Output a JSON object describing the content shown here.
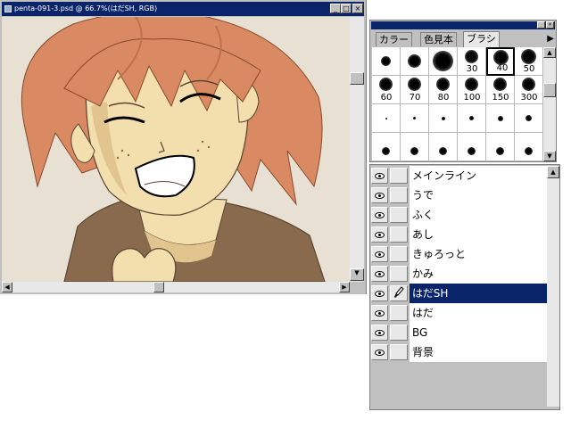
{
  "document": {
    "title": "penta-091-3.psd @ 66.7%(はだSH, RGB)",
    "buttons": {
      "minimize": "_",
      "maximize": "□",
      "close": "×"
    }
  },
  "brushes": {
    "tabs": [
      "カラー",
      "色見本",
      "ブラシ"
    ],
    "active_tab": "ブラシ",
    "tab_menu_icon": "triangle-right-icon",
    "close_glyph": "×",
    "rows": [
      [
        "",
        "",
        "",
        "30",
        "40",
        "50"
      ],
      [
        "60",
        "70",
        "80",
        "100",
        "150",
        "300"
      ],
      [
        "",
        "",
        "",
        "",
        "",
        ""
      ]
    ],
    "selected": "40"
  },
  "layers": {
    "items": [
      {
        "name": "メインライン",
        "visible": true,
        "active": false
      },
      {
        "name": "うで",
        "visible": true,
        "active": false
      },
      {
        "name": "ふく",
        "visible": true,
        "active": false
      },
      {
        "name": "あし",
        "visible": true,
        "active": false
      },
      {
        "name": "きゅろっと",
        "visible": true,
        "active": false
      },
      {
        "name": "かみ",
        "visible": true,
        "active": false
      },
      {
        "name": "はだSH",
        "visible": true,
        "active": true
      },
      {
        "name": "はだ",
        "visible": true,
        "active": false
      },
      {
        "name": "BG",
        "visible": true,
        "active": false
      },
      {
        "name": "背景",
        "visible": true,
        "active": false
      }
    ],
    "active_icon": "brush-icon"
  },
  "colors": {
    "titlebar": "#0a246a",
    "canvas_bg": "#e7e0d3",
    "hair": "#d98a63",
    "skin": "#f3dfae",
    "shirt": "#8a6a4c"
  }
}
